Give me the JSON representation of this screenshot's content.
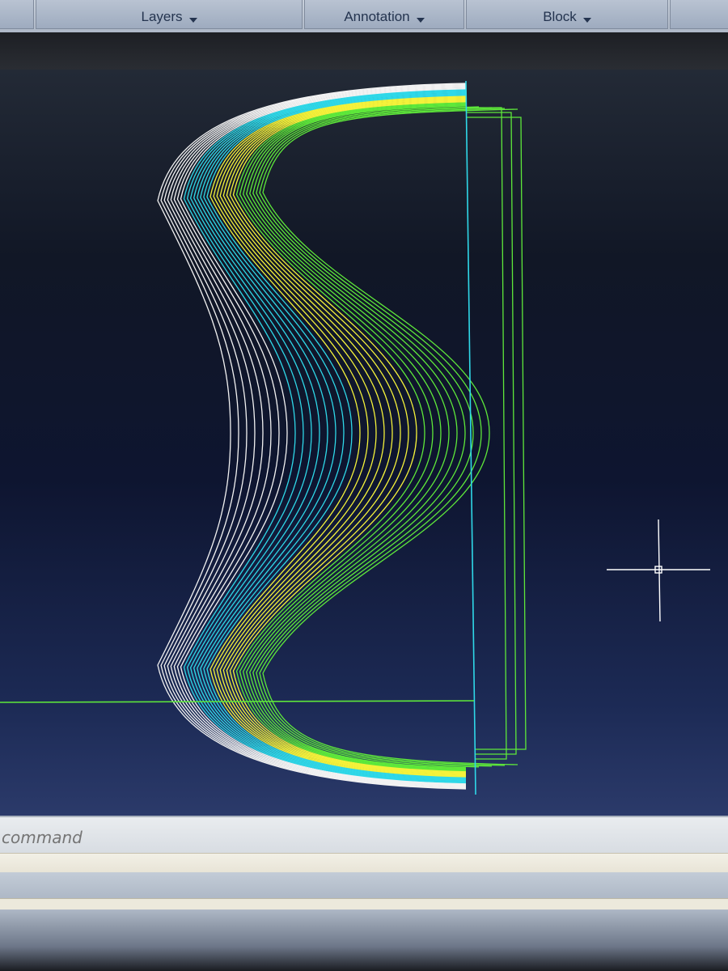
{
  "ribbon": {
    "panels": [
      {
        "id": "layers",
        "label": "Layers"
      },
      {
        "id": "annotation",
        "label": "Annotation"
      },
      {
        "id": "block",
        "label": "Block"
      }
    ]
  },
  "command_line": {
    "placeholder": "command"
  },
  "drawing": {
    "colors": {
      "white": "#f2f2f2",
      "cyan": "#2fd8e8",
      "yellow": "#f4f23a",
      "green": "#5ee83a",
      "crosshair": "#ffffff"
    },
    "curve_sets": [
      {
        "color": "white",
        "count": 8
      },
      {
        "color": "cyan",
        "count": 8
      },
      {
        "color": "yellow",
        "count": 8
      },
      {
        "color": "green",
        "count": 9
      }
    ],
    "cursor_icon": "crosshair-icon"
  }
}
